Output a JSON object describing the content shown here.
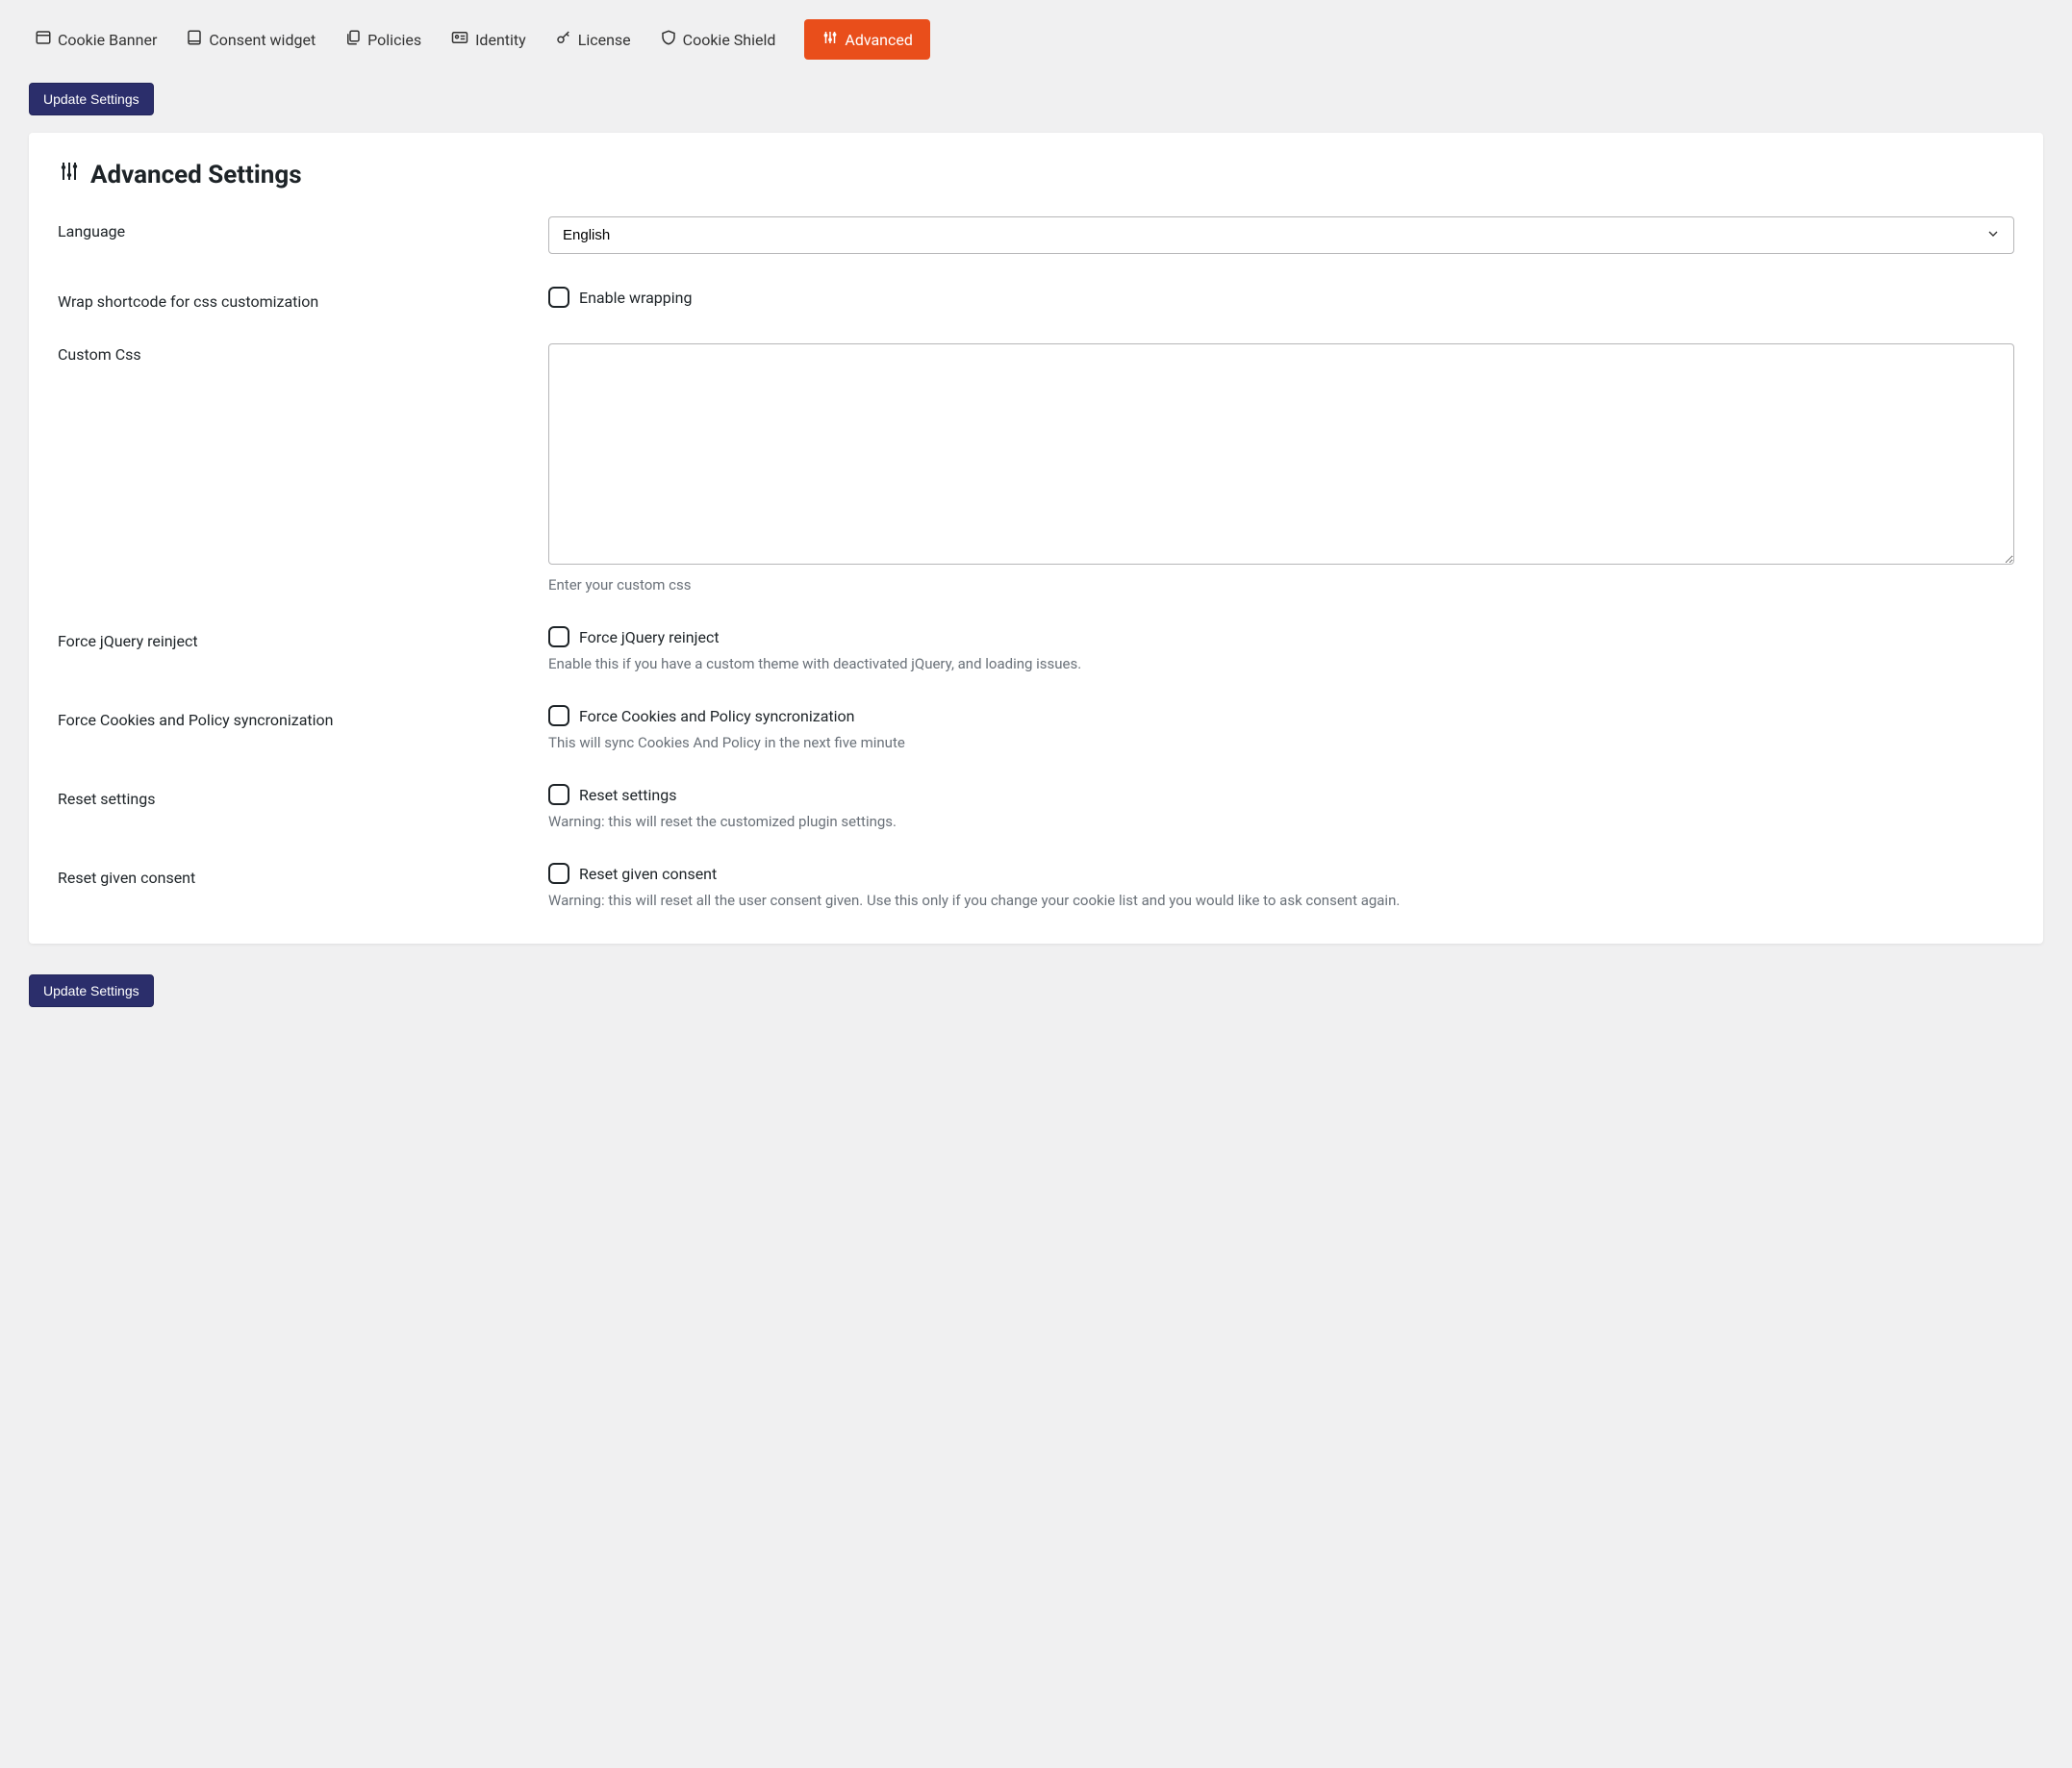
{
  "tabs": {
    "cookie_banner": "Cookie Banner",
    "consent_widget": "Consent widget",
    "policies": "Policies",
    "identity": "Identity",
    "license": "License",
    "cookie_shield": "Cookie Shield",
    "advanced": "Advanced"
  },
  "buttons": {
    "update_settings": "Update Settings"
  },
  "panel": {
    "title": "Advanced Settings"
  },
  "fields": {
    "language": {
      "label": "Language",
      "value": "English"
    },
    "wrap_shortcode": {
      "label": "Wrap shortcode for css customization",
      "checkbox_label": "Enable wrapping"
    },
    "custom_css": {
      "label": "Custom Css",
      "value": "",
      "help": "Enter your custom css"
    },
    "force_jquery": {
      "label": "Force jQuery reinject",
      "checkbox_label": "Force jQuery reinject",
      "help": "Enable this if you have a custom theme with deactivated jQuery, and loading issues."
    },
    "force_sync": {
      "label": "Force Cookies and Policy syncronization",
      "checkbox_label": "Force Cookies and Policy syncronization",
      "help": "This will sync Cookies And Policy in the next five minute"
    },
    "reset_settings": {
      "label": "Reset settings",
      "checkbox_label": "Reset settings",
      "help": "Warning: this will reset the customized plugin settings."
    },
    "reset_consent": {
      "label": "Reset given consent",
      "checkbox_label": "Reset given consent",
      "help": "Warning: this will reset all the user consent given. Use this only if you change your cookie list and you would like to ask consent again."
    }
  },
  "colors": {
    "accent": "#e94e1b",
    "primary_button": "#2b2e6b"
  }
}
